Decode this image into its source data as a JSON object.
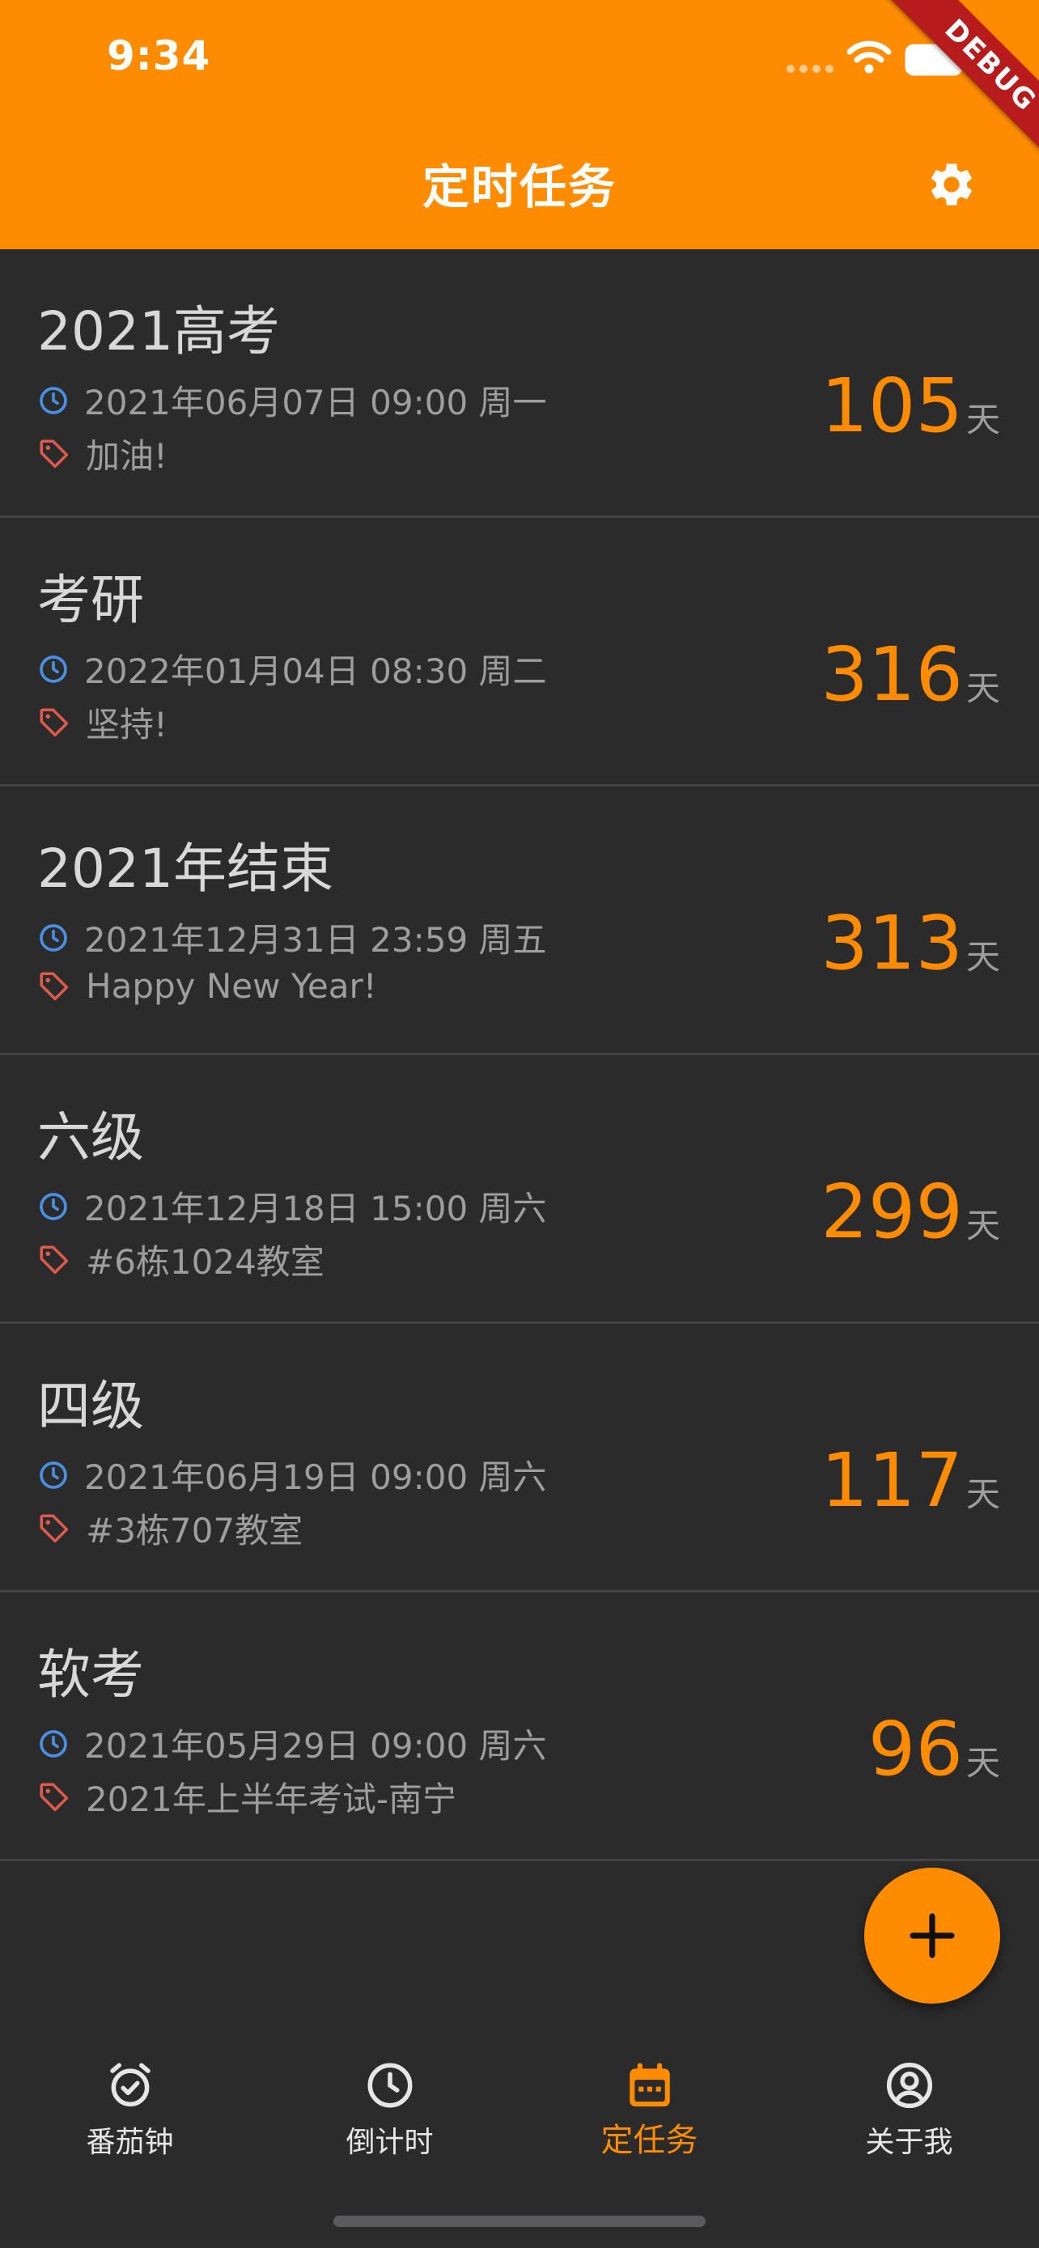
{
  "status_bar": {
    "time": "9:34"
  },
  "debug_banner": "DEBUG",
  "header": {
    "title": "定时任务"
  },
  "colors": {
    "accent": "#ff8c00",
    "background": "#2b2b2c",
    "clock_icon": "#4a90e2",
    "tag_icon": "#e05a4f"
  },
  "icons": {
    "settings": "gear-icon",
    "date": "clock-icon",
    "note": "tag-icon",
    "fab": "plus-icon"
  },
  "tasks": [
    {
      "title": "2021高考",
      "datetime": "2021年06月07日 09:00 周一",
      "note": "加油!",
      "days": "105",
      "unit": "天"
    },
    {
      "title": "考研",
      "datetime": "2022年01月04日 08:30 周二",
      "note": "坚持!",
      "days": "316",
      "unit": "天"
    },
    {
      "title": "2021年结束",
      "datetime": "2021年12月31日 23:59 周五",
      "note": "Happy New Year!",
      "days": "313",
      "unit": "天"
    },
    {
      "title": "六级",
      "datetime": "2021年12月18日 15:00 周六",
      "note": "#6栋1024教室",
      "days": "299",
      "unit": "天"
    },
    {
      "title": "四级",
      "datetime": "2021年06月19日 09:00 周六",
      "note": "#3栋707教室",
      "days": "117",
      "unit": "天"
    },
    {
      "title": "软考",
      "datetime": "2021年05月29日 09:00 周六",
      "note": "2021年上半年考试-南宁",
      "days": "96",
      "unit": "天"
    }
  ],
  "bottom_nav": {
    "active_index": 2,
    "items": [
      {
        "label": "番茄钟",
        "icon": "alarm-check-icon"
      },
      {
        "label": "倒计时",
        "icon": "clock-icon"
      },
      {
        "label": "定任务",
        "icon": "calendar-icon"
      },
      {
        "label": "关于我",
        "icon": "user-circle-icon"
      }
    ]
  }
}
